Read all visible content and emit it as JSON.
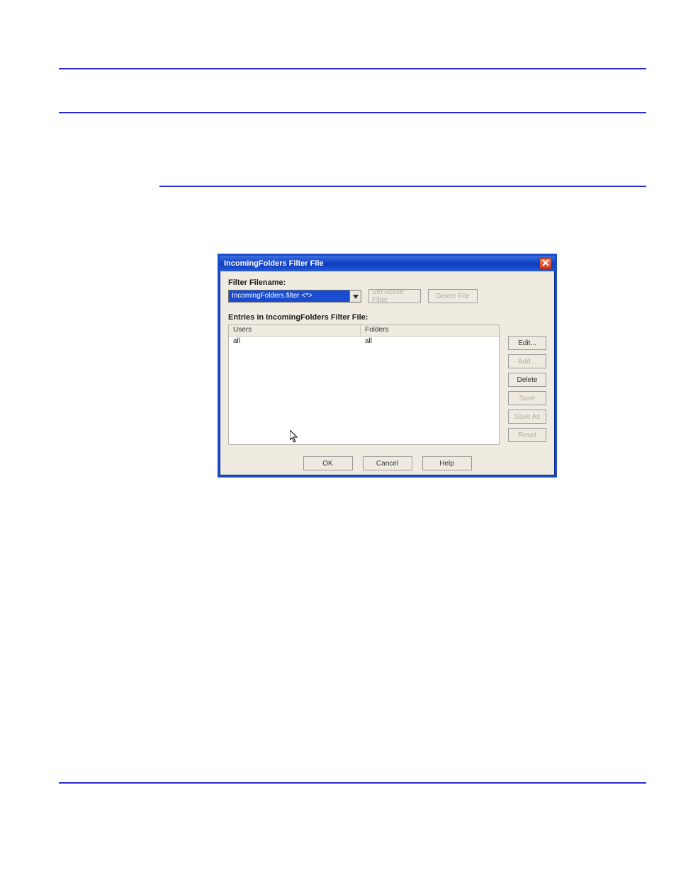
{
  "dialog": {
    "title": "IncomingFolders Filter File",
    "filter_filename_label": "Filter Filename:",
    "combo_value": "IncomingFolders.filter     <*>",
    "set_active_filter": "Set Active Filter",
    "delete_file": "Delete File",
    "entries_label": "Entries in IncomingFolders Filter File:",
    "columns": {
      "users": "Users",
      "folders": "Folders"
    },
    "rows": [
      {
        "users": "all",
        "folders": "all"
      }
    ],
    "side": {
      "edit": "Edit...",
      "add": "Add...",
      "delete": "Delete",
      "save": "Save",
      "save_as": "Save As",
      "reset": "Reset"
    },
    "bottom": {
      "ok": "OK",
      "cancel": "Cancel",
      "help": "Help"
    }
  }
}
